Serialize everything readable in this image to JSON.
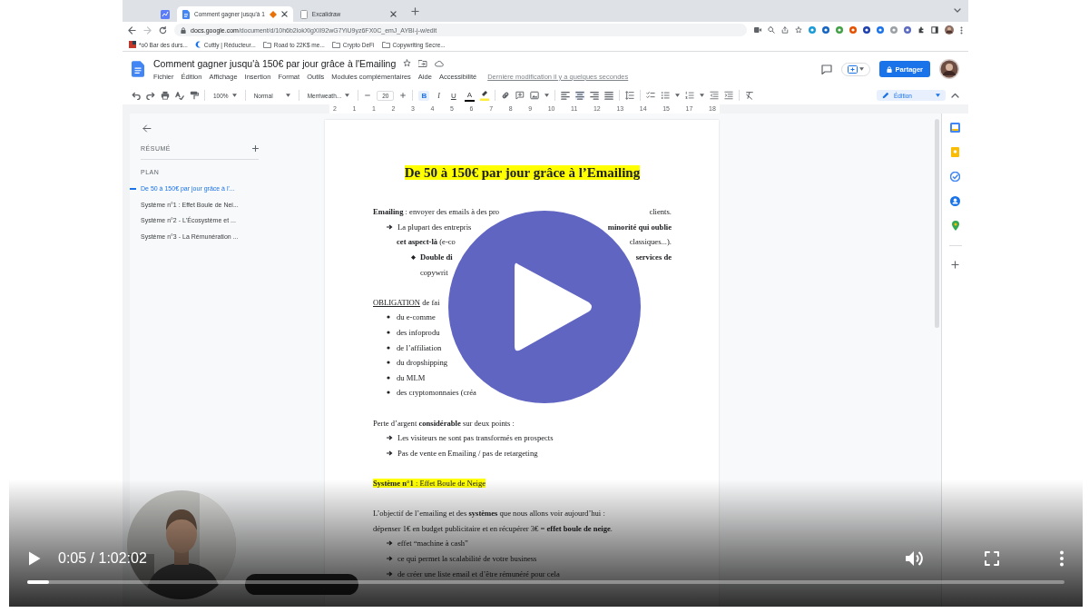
{
  "browser": {
    "tabs": [
      {
        "kind": "pinned",
        "selected": false
      },
      {
        "kind": "page",
        "title": "Comment gagner jusqu'à 1",
        "selected": true
      },
      {
        "kind": "page",
        "title": "Excalidraw",
        "selected": false
      }
    ],
    "url_host": "docs.google.com",
    "url_path": "/document/d/10h6b2lokXlgXII92wG7YiU9yz6FX0C_emJ_AYBI-j-w/edit",
    "bookmarks": [
      "*o0 Bar des durs...",
      "Cuttly | Réducteur...",
      "Road to 22K$ me...",
      "Crypto DeFi",
      "Copywriting Secre..."
    ]
  },
  "docs": {
    "title": "Comment gagner jusqu'à 150€ par jour grâce à l'Emailing",
    "menus": [
      "Fichier",
      "Édition",
      "Affichage",
      "Insertion",
      "Format",
      "Outils",
      "Modules complémentaires",
      "Aide",
      "Accessibilité"
    ],
    "last_edit": "Dernière modification il y a quelques secondes",
    "share_button": "Partager"
  },
  "toolbar": {
    "zoom": "100%",
    "style": "Normal",
    "font": "Merriweath...",
    "size": "20",
    "format_buttons": [
      {
        "label": "B",
        "selected": true
      },
      {
        "label": "I",
        "selected": false
      },
      {
        "label": "U",
        "selected": false
      },
      {
        "label": "A",
        "selected": false
      }
    ],
    "mode": "Édition"
  },
  "ruler": [
    "2",
    "1",
    "1",
    "2",
    "3",
    "4",
    "5",
    "6",
    "7",
    "8",
    "9",
    "10",
    "11",
    "12",
    "13",
    "14",
    "15",
    "17",
    "18"
  ],
  "outline": {
    "summary_label": "RÉSUMÉ",
    "plan_label": "PLAN",
    "items": [
      {
        "text": "De 50 à 150€ par jour grâce à l'...",
        "selected": true
      },
      {
        "text": "Système n°1 : Effet Boule de Nei...",
        "selected": false
      },
      {
        "text": "Système n°2 - L'Écosystème et ...",
        "selected": false
      },
      {
        "text": "Système n°3 - La Rémunération ...",
        "selected": false
      }
    ]
  },
  "page": {
    "title": {
      "text": "De 50 à 150€ par jour grâce à l’Emailing",
      "highlight": true
    },
    "blocks": [
      {
        "lines": [
          {
            "kind": "text",
            "left": "**Emailing** : envoyer des emails à des pro",
            "right": "clients.",
            "highlight": false
          },
          {
            "kind": "arrow",
            "left": "La plupart des entrepris",
            "right": "**minorité qui oublie**",
            "highlight": false
          },
          {
            "kind": "cont",
            "left": "**cet aspect-là** (e-co",
            "right": "classiques...).",
            "highlight": false
          },
          {
            "kind": "subbullet",
            "left": "**Double di**",
            "right": "**services de**",
            "highlight": false
          },
          {
            "kind": "subcont",
            "left": "copywrit",
            "highlight": false
          }
        ]
      },
      {
        "lines": [
          {
            "kind": "text",
            "lead": "OBLIGATION",
            "left": "de fai",
            "highlight": false
          },
          {
            "kind": "bullet",
            "left": "du e-comme",
            "highlight": false
          },
          {
            "kind": "bullet",
            "left": "des infoprodu",
            "highlight": false
          },
          {
            "kind": "bullet",
            "left": "de l’affiliation",
            "highlight": false
          },
          {
            "kind": "bullet",
            "left": "du dropshipping",
            "highlight": false
          },
          {
            "kind": "bullet",
            "left": "du MLM",
            "highlight": false
          },
          {
            "kind": "bullet",
            "left": "des cryptomonnaies (créa",
            "highlight": false
          }
        ]
      },
      {
        "lines": [
          {
            "kind": "text",
            "left": "Perte d’argent **considérable** sur deux points :",
            "highlight": false
          },
          {
            "kind": "arrow",
            "left": "Les visiteurs ne sont pas transformés en prospects",
            "highlight": false
          },
          {
            "kind": "arrow",
            "left": "Pas de vente en Emailing / pas de retargeting",
            "highlight": false
          }
        ]
      },
      {
        "lines": [
          {
            "kind": "text",
            "left": "**Système n°1** : Effet Boule de Neige",
            "highlight": true
          }
        ]
      },
      {
        "lines": [
          {
            "kind": "text",
            "left": "L’objectif de l’emailing et des **systèmes** que nous allons voir aujourd’hui :",
            "highlight": false
          },
          {
            "kind": "text",
            "left": "dépenser 1€ en budget publicitaire et en récupérer 3€ = **effet boule de neige**.",
            "highlight": false
          },
          {
            "kind": "arrow",
            "left": "effet “machine à cash”",
            "highlight": false
          },
          {
            "kind": "arrow",
            "left": "ce qui permet la scalabilité de votre business",
            "highlight": false
          },
          {
            "kind": "arrow",
            "left": "de créer une liste email et d’être rémunéré pour cela",
            "highlight": false
          }
        ]
      }
    ]
  },
  "player": {
    "time": "0:05 / 1:02:02",
    "level": 0.021
  }
}
